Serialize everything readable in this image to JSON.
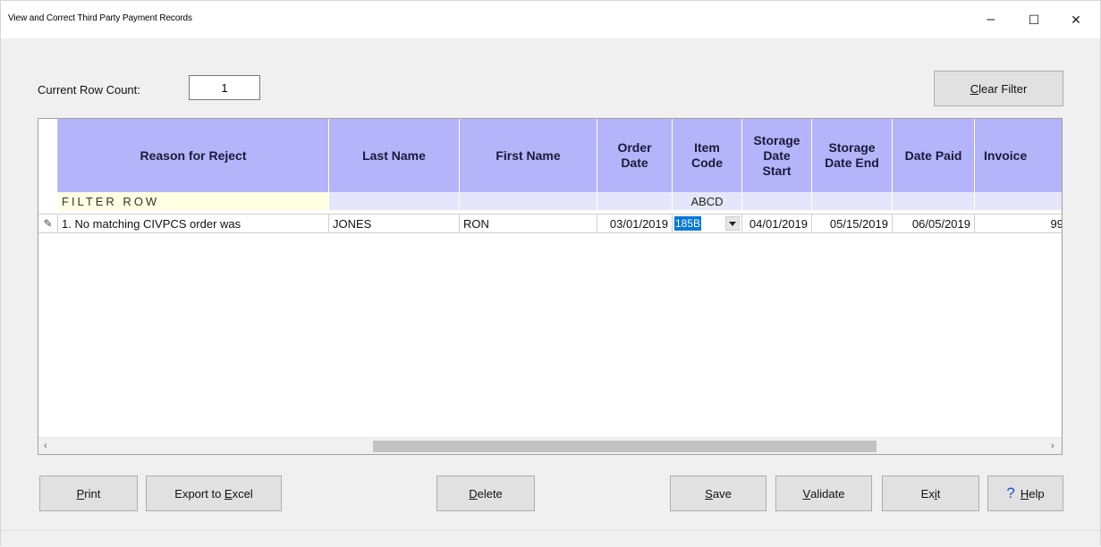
{
  "window": {
    "title": "View and Correct Third Party Payment Records",
    "minimize_glyph": "–",
    "maximize_glyph": "☐",
    "close_glyph": "✕"
  },
  "row_count": {
    "label": "Current Row Count:",
    "value": "1"
  },
  "buttons": {
    "clear_filter": {
      "pre": "",
      "u": "C",
      "post": "lear Filter"
    },
    "print": {
      "pre": "",
      "u": "P",
      "post": "rint"
    },
    "export": {
      "pre": "Export to ",
      "u": "E",
      "post": "xcel"
    },
    "delete": {
      "pre": "",
      "u": "D",
      "post": "elete"
    },
    "save": {
      "pre": "",
      "u": "S",
      "post": "ave"
    },
    "validate": {
      "pre": "",
      "u": "V",
      "post": "alidate"
    },
    "exit": {
      "pre": "Ex",
      "u": "i",
      "post": "t"
    },
    "help": {
      "pre": "",
      "u": "H",
      "post": "elp",
      "icon": "?"
    }
  },
  "grid": {
    "columns": [
      "Reason for Reject",
      "Last Name",
      "First Name",
      "Order\nDate",
      "Item\nCode",
      "Storage\nDate\nStart",
      "Storage\nDate End",
      "Date Paid",
      "Invoice"
    ],
    "filter_row": {
      "label": "FILTER ROW",
      "item_code": "ABCD"
    },
    "rows": [
      {
        "edit_indicator": "✎",
        "reason": "1. No matching CIVPCS order was",
        "last_name": "JONES",
        "first_name": "RON",
        "order_date": "03/01/2019",
        "item_code": "185B",
        "storage_start": "04/01/2019",
        "storage_end": "05/15/2019",
        "date_paid": "06/05/2019",
        "invoice": "99"
      }
    ],
    "scroll_left": "‹",
    "scroll_right": "›"
  },
  "colors": {
    "header_bg": "#b4b4fa",
    "filter_bg": "#e6e6fa",
    "filter_label_bg": "#ffffe1",
    "selection": "#0078d7"
  }
}
